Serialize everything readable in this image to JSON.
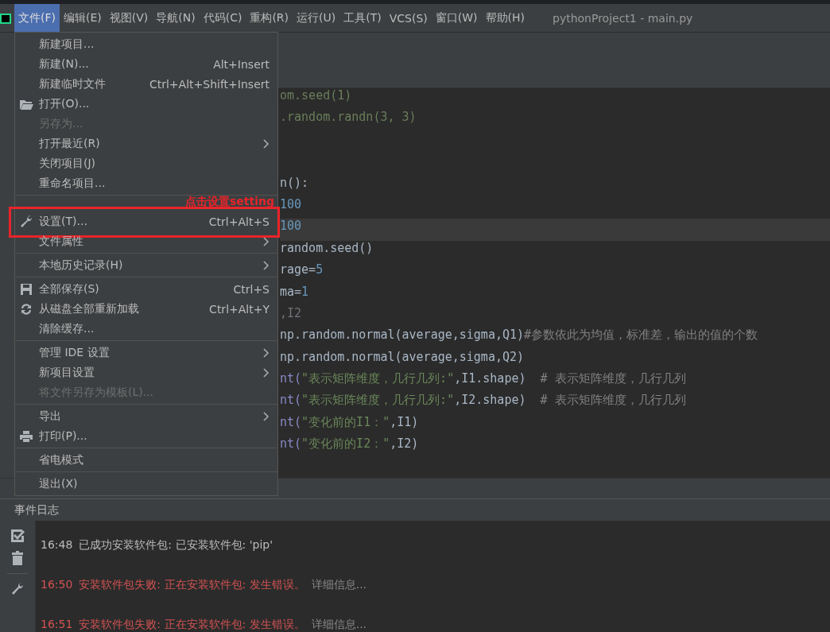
{
  "menubar": {
    "items": [
      {
        "label": "文件(F)",
        "selected": true
      },
      {
        "label": "编辑(E)",
        "selected": false
      },
      {
        "label": "视图(V)",
        "selected": false
      },
      {
        "label": "导航(N)",
        "selected": false
      },
      {
        "label": "代码(C)",
        "selected": false
      },
      {
        "label": "重构(R)",
        "selected": false
      },
      {
        "label": "运行(U)",
        "selected": false
      },
      {
        "label": "工具(T)",
        "selected": false
      },
      {
        "label": "VCS(S)",
        "selected": false
      },
      {
        "label": "窗口(W)",
        "selected": false
      },
      {
        "label": "帮助(H)",
        "selected": false
      }
    ],
    "title": "pythonProject1 - main.py"
  },
  "file_menu": {
    "items": [
      {
        "kind": "item",
        "label": "新建项目...",
        "disabled": false,
        "submenu": false
      },
      {
        "kind": "item",
        "label": "新建(N)...",
        "shortcut": "Alt+Insert",
        "disabled": false,
        "submenu": false
      },
      {
        "kind": "item",
        "label": "新建临时文件",
        "shortcut": "Ctrl+Alt+Shift+Insert",
        "disabled": false,
        "submenu": false
      },
      {
        "kind": "folder",
        "label": "打开(O)...",
        "disabled": false,
        "submenu": false
      },
      {
        "kind": "item",
        "label": "另存为...",
        "disabled": true,
        "submenu": false
      },
      {
        "kind": "item",
        "label": "打开最近(R)",
        "disabled": false,
        "submenu": true
      },
      {
        "kind": "item",
        "label": "关闭项目(J)",
        "disabled": false,
        "submenu": false
      },
      {
        "kind": "item",
        "label": "重命名项目...",
        "disabled": false,
        "submenu": false
      },
      {
        "kind": "separator"
      },
      {
        "kind": "wrench",
        "label": "设置(T)...",
        "shortcut": "Ctrl+Alt+S",
        "disabled": false,
        "submenu": false,
        "annotation": "点击设置setting"
      },
      {
        "kind": "item",
        "label": "文件属性",
        "disabled": false,
        "submenu": true
      },
      {
        "kind": "separator"
      },
      {
        "kind": "item",
        "label": "本地历史记录(H)",
        "disabled": false,
        "submenu": true
      },
      {
        "kind": "separator"
      },
      {
        "kind": "floppy",
        "label": "全部保存(S)",
        "shortcut": "Ctrl+S",
        "disabled": false,
        "submenu": false
      },
      {
        "kind": "reload",
        "label": "从磁盘全部重新加载",
        "shortcut": "Ctrl+Alt+Y",
        "disabled": false,
        "submenu": false
      },
      {
        "kind": "item",
        "label": "清除缓存...",
        "disabled": false,
        "submenu": false
      },
      {
        "kind": "separator"
      },
      {
        "kind": "item",
        "label": "管理 IDE 设置",
        "disabled": false,
        "submenu": true
      },
      {
        "kind": "item",
        "label": "新项目设置",
        "disabled": false,
        "submenu": true
      },
      {
        "kind": "item",
        "label": "将文件另存为模板(L)...",
        "disabled": true,
        "submenu": false
      },
      {
        "kind": "separator"
      },
      {
        "kind": "item",
        "label": "导出",
        "disabled": false,
        "submenu": true
      },
      {
        "kind": "printer",
        "label": "打印(P)...",
        "disabled": false,
        "submenu": false
      },
      {
        "kind": "separator"
      },
      {
        "kind": "item",
        "label": "省电模式",
        "disabled": false,
        "submenu": false
      },
      {
        "kind": "separator"
      },
      {
        "kind": "item",
        "label": "退出(X)",
        "disabled": false,
        "submenu": false
      }
    ]
  },
  "editor": {
    "lines": [
      {
        "kind": "code",
        "current": false,
        "tokens": [
          {
            "text": "om.seed(1)",
            "kind": "dim"
          }
        ]
      },
      {
        "kind": "code",
        "current": false,
        "tokens": [
          {
            "text": ".random.randn(3, 3)",
            "kind": "dim"
          }
        ]
      },
      {
        "kind": "blank"
      },
      {
        "kind": "blank"
      },
      {
        "kind": "code",
        "current": false,
        "tokens": [
          {
            "text": "n():",
            "kind": "plain"
          }
        ]
      },
      {
        "kind": "code",
        "current": false,
        "tokens": [
          {
            "text": "100",
            "kind": "number"
          }
        ]
      },
      {
        "kind": "code",
        "current": true,
        "tokens": [
          {
            "text": "100",
            "kind": "number"
          }
        ]
      },
      {
        "kind": "code",
        "current": false,
        "tokens": [
          {
            "text": "random.seed()",
            "kind": "plain"
          }
        ]
      },
      {
        "kind": "code",
        "current": false,
        "tokens": [
          {
            "text": "rage=",
            "kind": "plain"
          },
          {
            "text": "5",
            "kind": "number"
          }
        ]
      },
      {
        "kind": "code",
        "current": false,
        "tokens": [
          {
            "text": "ma=",
            "kind": "plain"
          },
          {
            "text": "1",
            "kind": "number"
          }
        ]
      },
      {
        "kind": "code",
        "current": false,
        "tokens": [
          {
            "text": ",I2",
            "kind": "faded"
          }
        ]
      },
      {
        "kind": "code",
        "current": false,
        "tokens": [
          {
            "text": "np.random.normal(average,sigma,Q1)",
            "kind": "plain"
          },
          {
            "text": "#参数依此为均值，标准差，输出的值的个数",
            "kind": "comment"
          }
        ]
      },
      {
        "kind": "code",
        "current": false,
        "tokens": [
          {
            "text": "np.random.normal(average,sigma,Q2)",
            "kind": "plain"
          }
        ]
      },
      {
        "kind": "code",
        "current": false,
        "tokens": [
          {
            "text": "nt(",
            "kind": "keyword"
          },
          {
            "text": "\"表示矩阵维度，几行几列:\"",
            "kind": "string"
          },
          {
            "text": ",I1.shape)  ",
            "kind": "plain"
          },
          {
            "text": "# 表示矩阵维度，几行几列",
            "kind": "comment"
          }
        ]
      },
      {
        "kind": "code",
        "current": false,
        "tokens": [
          {
            "text": "nt(",
            "kind": "keyword"
          },
          {
            "text": "\"表示矩阵维度，几行几列:\"",
            "kind": "string"
          },
          {
            "text": ",I2.shape)  ",
            "kind": "plain"
          },
          {
            "text": "# 表示矩阵维度，几行几列",
            "kind": "comment"
          }
        ]
      },
      {
        "kind": "code",
        "current": false,
        "tokens": [
          {
            "text": "nt(",
            "kind": "keyword"
          },
          {
            "text": "\"变化前的I1：\"",
            "kind": "string"
          },
          {
            "text": ",I1)",
            "kind": "plain"
          }
        ]
      },
      {
        "kind": "code",
        "current": false,
        "tokens": [
          {
            "text": "nt(",
            "kind": "keyword"
          },
          {
            "text": "\"变化前的I2：\"",
            "kind": "string"
          },
          {
            "text": ",I2)",
            "kind": "plain"
          }
        ]
      }
    ]
  },
  "event_log": {
    "title": "事件日志",
    "entries": [
      {
        "time": "16:48",
        "message": "已成功安装软件包: 已安装软件包: 'pip'",
        "kind": "success"
      },
      {
        "time": "16:50",
        "message": "安装软件包失败: 正在安装软件包: 发生错误。",
        "kind": "error",
        "link": "详细信息..."
      },
      {
        "time": "16:51",
        "message": "安装软件包失败: 正在安装软件包: 发生错误。",
        "kind": "error",
        "link": "详细信息..."
      }
    ]
  }
}
